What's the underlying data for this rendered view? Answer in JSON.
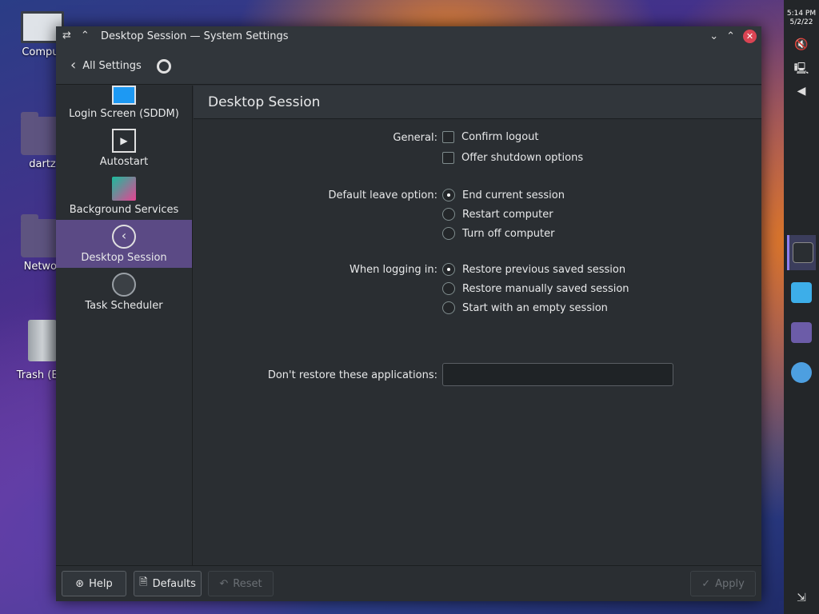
{
  "desktop": {
    "icons": [
      {
        "label": "Comput"
      },
      {
        "label": "dartz"
      },
      {
        "label": "Networ"
      },
      {
        "label": "Trash (Em"
      }
    ]
  },
  "panel": {
    "time": "5:14 PM",
    "date": "5/2/22"
  },
  "window": {
    "title": "Desktop Session — System Settings",
    "back_label": "All Settings"
  },
  "sidebar": {
    "items": [
      {
        "label": "Login Screen (SDDM)",
        "icon": "monitor-icon"
      },
      {
        "label": "Autostart",
        "icon": "play-icon"
      },
      {
        "label": "Background Services",
        "icon": "bell-icon"
      },
      {
        "label": "Desktop Session",
        "icon": "back-circle-icon",
        "selected": true
      },
      {
        "label": "Task Scheduler",
        "icon": "clock-icon"
      }
    ]
  },
  "content": {
    "heading": "Desktop Session",
    "general": {
      "label": "General:",
      "confirm_logout": "Confirm logout",
      "offer_shutdown": "Offer shutdown options"
    },
    "leave": {
      "label": "Default leave option:",
      "end_session": "End current session",
      "restart": "Restart computer",
      "turn_off": "Turn off computer",
      "selected": "End current session"
    },
    "login": {
      "label": "When logging in:",
      "restore_previous": "Restore previous saved session",
      "restore_manual": "Restore manually saved session",
      "start_empty": "Start with an empty session",
      "selected": "Restore previous saved session"
    },
    "exclude": {
      "label": "Don't restore these applications:",
      "value": ""
    }
  },
  "footer": {
    "help": "Help",
    "defaults": "Defaults",
    "reset": "Reset",
    "apply": "Apply"
  }
}
